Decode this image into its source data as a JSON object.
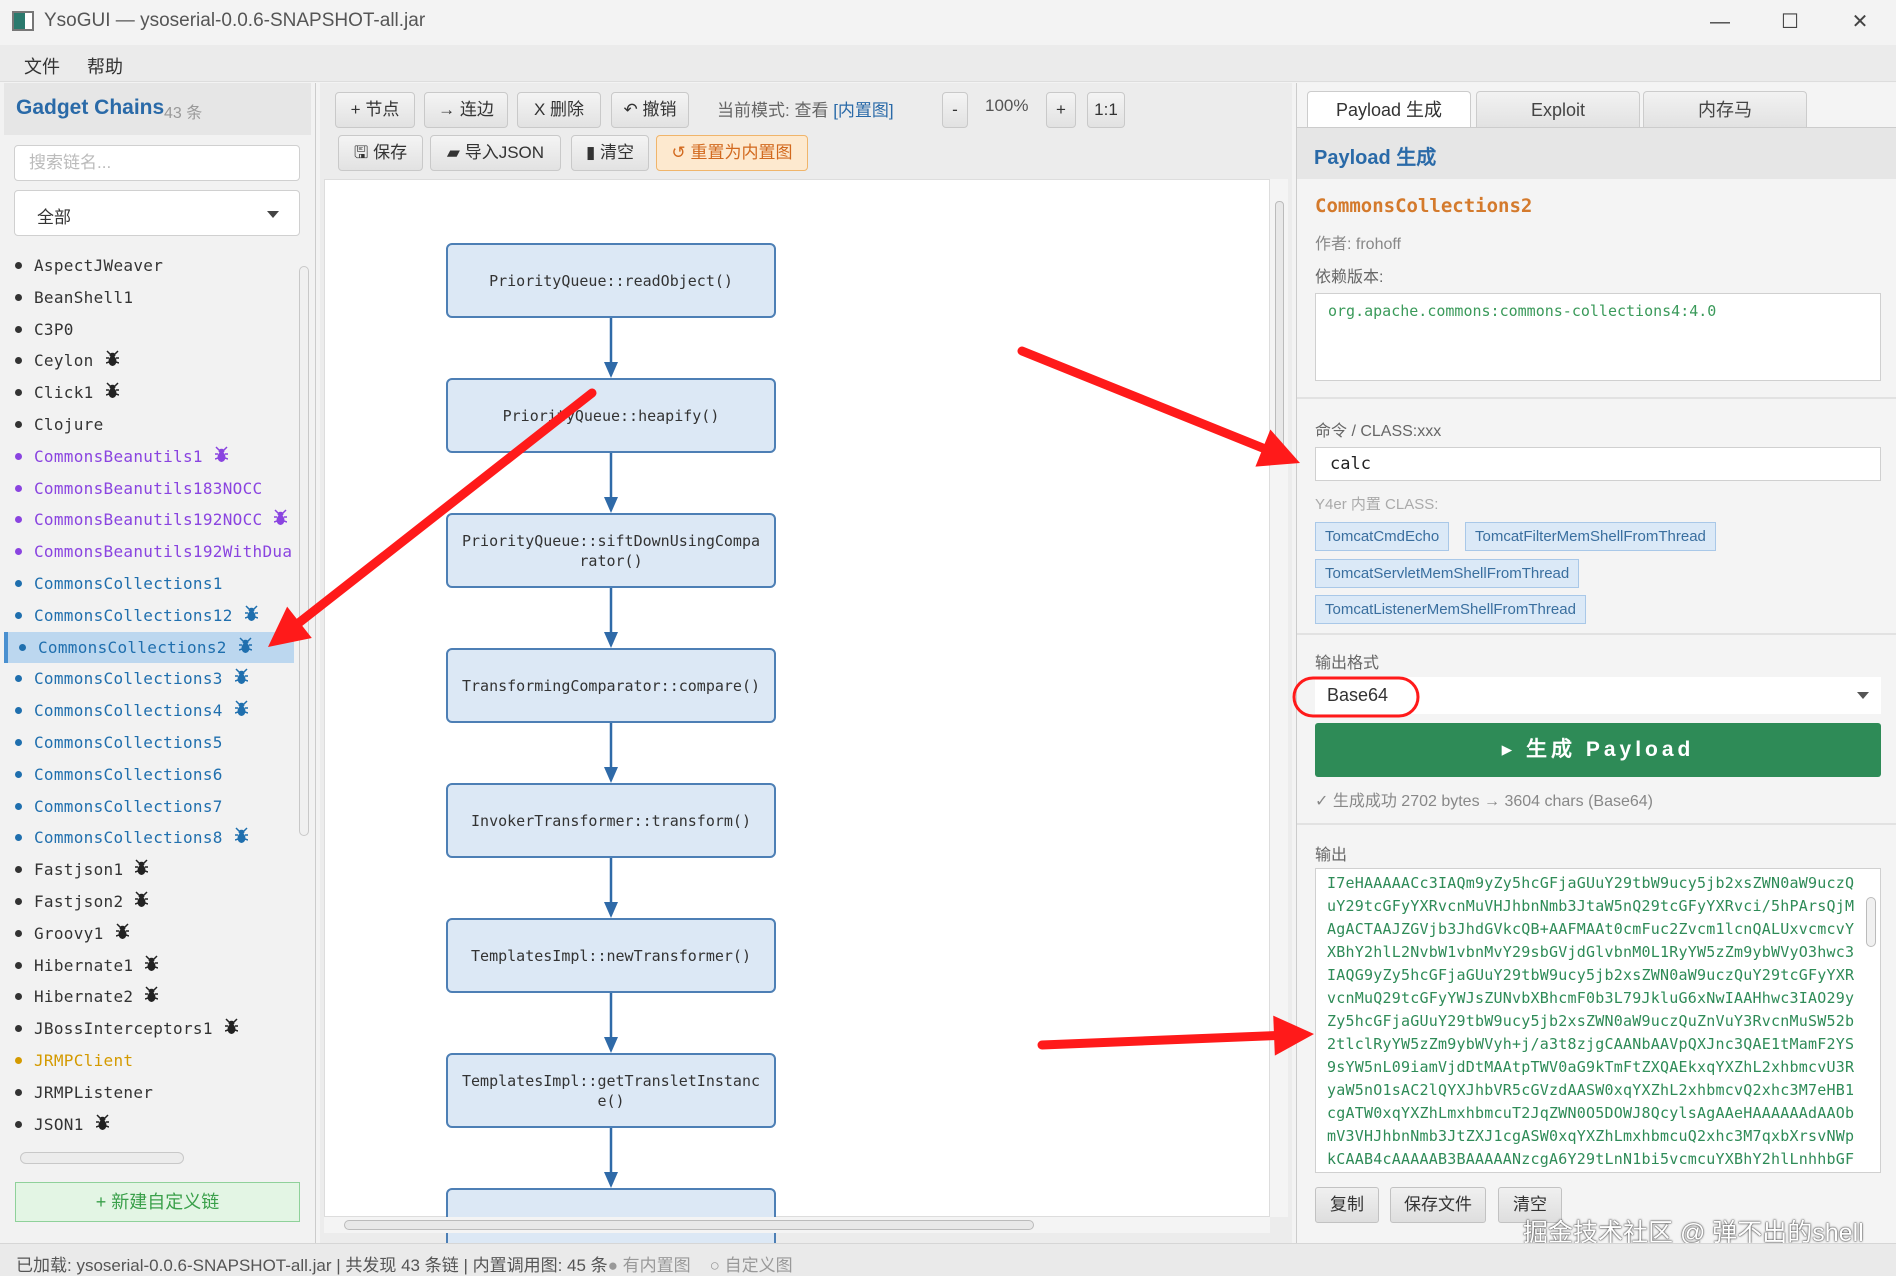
{
  "window": {
    "title": "YsoGUI  —  ysoserial-0.0.6-SNAPSHOT-all.jar",
    "minimize": "—",
    "maximize": "☐",
    "close": "✕"
  },
  "menu": [
    "文件",
    "帮助"
  ],
  "sidebar": {
    "title": "Gadget Chains",
    "count": "43 条",
    "search_placeholder": "搜索链名...",
    "filter": "全部",
    "colors": {
      "default": "#333333",
      "beanutils": "#8a44e0",
      "collections": "#1f6fae",
      "jrmp": "#d49a00"
    },
    "items": [
      {
        "name": "AspectJWeaver",
        "kind": "default",
        "bug": false
      },
      {
        "name": "BeanShell1",
        "kind": "default",
        "bug": false
      },
      {
        "name": "C3P0",
        "kind": "default",
        "bug": false
      },
      {
        "name": "Ceylon",
        "kind": "default",
        "bug": true
      },
      {
        "name": "Click1",
        "kind": "default",
        "bug": true
      },
      {
        "name": "Clojure",
        "kind": "default",
        "bug": false
      },
      {
        "name": "CommonsBeanutils1",
        "kind": "beanutils",
        "bug": true
      },
      {
        "name": "CommonsBeanutils183NOCC",
        "kind": "beanutils",
        "bug": false
      },
      {
        "name": "CommonsBeanutils192NOCC",
        "kind": "beanutils",
        "bug": true
      },
      {
        "name": "CommonsBeanutils192WithDua",
        "kind": "beanutils",
        "bug": false
      },
      {
        "name": "CommonsCollections1",
        "kind": "collections",
        "bug": false
      },
      {
        "name": "CommonsCollections12",
        "kind": "collections",
        "bug": true
      },
      {
        "name": "CommonsCollections2",
        "kind": "collections",
        "bug": true,
        "selected": true
      },
      {
        "name": "CommonsCollections3",
        "kind": "collections",
        "bug": true
      },
      {
        "name": "CommonsCollections4",
        "kind": "collections",
        "bug": true
      },
      {
        "name": "CommonsCollections5",
        "kind": "collections",
        "bug": false
      },
      {
        "name": "CommonsCollections6",
        "kind": "collections",
        "bug": false
      },
      {
        "name": "CommonsCollections7",
        "kind": "collections",
        "bug": false
      },
      {
        "name": "CommonsCollections8",
        "kind": "collections",
        "bug": true
      },
      {
        "name": "Fastjson1",
        "kind": "default",
        "bug": true
      },
      {
        "name": "Fastjson2",
        "kind": "default",
        "bug": true
      },
      {
        "name": "Groovy1",
        "kind": "default",
        "bug": true
      },
      {
        "name": "Hibernate1",
        "kind": "default",
        "bug": true
      },
      {
        "name": "Hibernate2",
        "kind": "default",
        "bug": true
      },
      {
        "name": "JBossInterceptors1",
        "kind": "default",
        "bug": true
      },
      {
        "name": "JRMPClient",
        "kind": "jrmp",
        "bug": false
      },
      {
        "name": "JRMPListener",
        "kind": "default",
        "bug": false
      },
      {
        "name": "JSON1",
        "kind": "default",
        "bug": true
      }
    ],
    "new_chain_button": "+ 新建自定义链"
  },
  "toolbar": {
    "add_node": "+ 节点",
    "connect": "→ 连边",
    "delete": "X 删除",
    "undo": "↶ 撤销",
    "mode_label": "当前模式: 查看",
    "mode_tag": "[内置图]",
    "zoom_out": "-",
    "zoom": "100%",
    "zoom_in": "+",
    "reset_zoom": "1:1",
    "save": "🖫 保存",
    "import": "▰ 导入JSON",
    "clear": "▮ 清空",
    "reset_builtin": "↺ 重置为内置图"
  },
  "diagram": {
    "nodes": [
      "PriorityQueue::readObject()",
      "PriorityQueue::heapify()",
      "PriorityQueue::siftDownUsingComparator()",
      "TransformingComparator::compare()",
      "InvokerTransformer::transform()",
      "TemplatesImpl::newTransformer()",
      "TemplatesImpl::getTransletInstance()",
      ""
    ],
    "node_color": "#dce8f5",
    "edge_color": "#2f6aa8"
  },
  "right": {
    "tabs": [
      "Payload 生成",
      "Exploit",
      "内存马"
    ],
    "active_tab": 0,
    "pane_title": "Payload 生成",
    "chain_name": "CommonsCollections2",
    "author": "作者: frohoff",
    "dep_label": "依赖版本:",
    "dependency": "org.apache.commons:commons-collections4:4.0",
    "cmd_label": "命令 / CLASS:xxx",
    "cmd_value": "calc",
    "builtin_label": "Y4er 内置 CLASS:",
    "builtin_classes": [
      "TomcatCmdEcho",
      "TomcatFilterMemShellFromThread",
      "TomcatServletMemShellFromThread",
      "TomcatListenerMemShellFromThread"
    ],
    "format_label": "输出格式",
    "format_value": "Base64",
    "generate_button": "▸ 生成 Payload",
    "gen_status": "✓ 生成成功  2702 bytes → 3604 chars (Base64)",
    "output_label": "输出",
    "output_lines": [
      "I7eHAAAAACc3IAQm9yZy5hcGFjaGUuY29tbW9ucy5jb2xsZWN0aW9uczQ",
      "uY29tcGFyYXRvcnMuVHJhbnNmb3JtaW5nQ29tcGFyYXRvci/5hPArsQjM",
      "AgACTAAJZGVjb3JhdGVkcQB+AAFMAAt0cmFuc2Zvcm1lcnQALUxvcmcvY",
      "XBhY2hlL2NvbW1vbnMvY29sbGVjdGlvbnM0L1RyYW5zZm9ybWVyO3hwc3",
      "IAQG9yZy5hcGFjaGUuY29tbW9ucy5jb2xsZWN0aW9uczQuY29tcGFyYXR",
      "vcnMuQ29tcGFyYWJsZUNvbXBhcmF0b3L79JkluG6xNwIAAHhwc3IAO29y",
      "Zy5hcGFjaGUuY29tbW9ucy5jb2xsZWN0aW9uczQuZnVuY3RvcnMuSW52b",
      "2tlclRyYW5zZm9ybWVyh+j/a3t8zjgCAANbAAVpQXJnc3QAE1tMamF2YS",
      "9sYW5nL09iamVjdDtMAAtpTWV0aG9kTmFtZXQAEkxqYXZhL2xhbmcvU3R",
      "yaW5nO1sAC2lQYXJhbVR5cGVzdAASW0xqYXZhL2xhbmcvQ2xhc3M7eHB1",
      "cgATW0xqYXZhLmxhbmcuT2JqZWN0O5DOWJ8QcylsAgAAeHAAAAAAdAAOb",
      "mV3VHJhbnNmb3JtZXJ1cgASW0xqYXZhLmxhbmcuQ2xhc3M7qxbXrsvNWp",
      "kCAAB4cAAAAAB3BAAAAANzcgA6Y29tLnN1bi5vcmcuYXBhY2hlLnhhbGF"
    ],
    "copy_button": "复制",
    "save_file_button": "保存文件",
    "clear_button": "清空",
    "accent": "#2a6aa8",
    "generate_color": "#2e8b57"
  },
  "watermark": "掘金技术社区 @ 弹不出的shell",
  "statusbar": {
    "loaded": "已加载: ysoserial-0.0.6-SNAPSHOT-all.jar  |  共发现 43 条链  |  内置调用图: 45 条",
    "legend_builtin": "● 有内置图",
    "legend_custom": "○ 自定义图"
  },
  "annotation_color": "#ff1a1a"
}
